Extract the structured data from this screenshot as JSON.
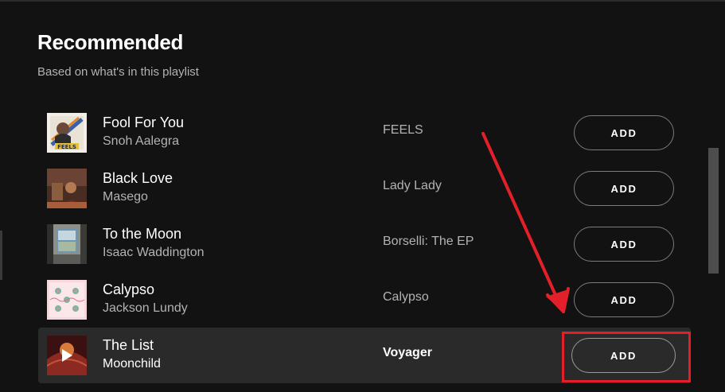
{
  "section": {
    "title": "Recommended",
    "subtitle": "Based on what's in this playlist"
  },
  "tracks": [
    {
      "name": "Fool For You",
      "artist": "Snoh Aalegra",
      "album": "FEELS",
      "add_label": "ADD",
      "art_icon": "album-art-feels"
    },
    {
      "name": "Black Love",
      "artist": "Masego",
      "album": "Lady Lady",
      "add_label": "ADD",
      "art_icon": "album-art-lady-lady"
    },
    {
      "name": "To the Moon",
      "artist": "Isaac Waddington",
      "album": "Borselli: The EP",
      "add_label": "ADD",
      "art_icon": "album-art-borselli"
    },
    {
      "name": "Calypso",
      "artist": "Jackson Lundy",
      "album": "Calypso",
      "add_label": "ADD",
      "art_icon": "album-art-calypso"
    },
    {
      "name": "The List",
      "artist": "Moonchild",
      "album": "Voyager",
      "add_label": "ADD",
      "art_icon": "album-art-voyager",
      "hovered": true
    }
  ],
  "colors": {
    "background": "#121212",
    "row_hover": "#2a2a2a",
    "text_primary": "#ffffff",
    "text_secondary": "#b3b3b3",
    "annotation": "#e3202a"
  },
  "annotation": {
    "type": "red arrow and highlight box",
    "target": "add-button for The List"
  },
  "icons": {
    "play": "play-icon"
  }
}
